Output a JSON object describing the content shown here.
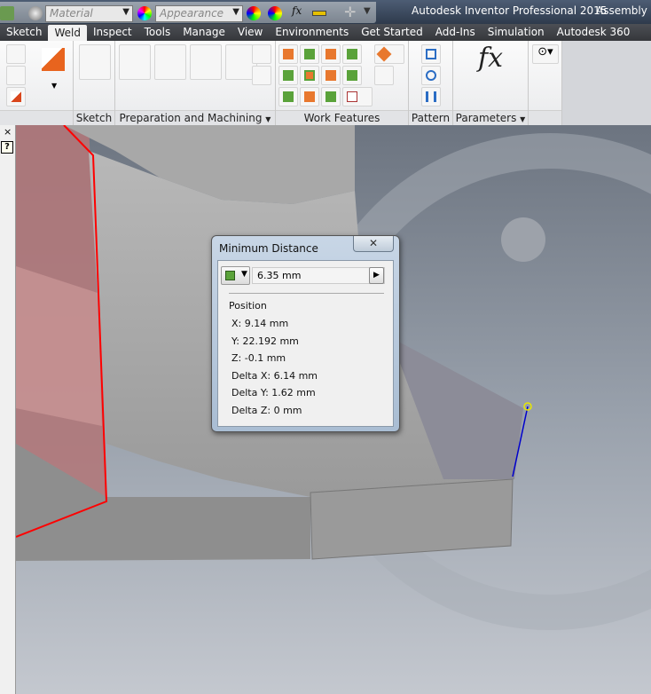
{
  "quick_access": {
    "material_placeholder": "Material",
    "appearance_placeholder": "Appearance",
    "fx_label": "fx"
  },
  "window": {
    "title": "Autodesk Inventor Professional 2015",
    "doc_title": "Assembly S"
  },
  "tabs": [
    {
      "label": "Sketch"
    },
    {
      "label": "Weld",
      "active": true
    },
    {
      "label": "Inspect"
    },
    {
      "label": "Tools"
    },
    {
      "label": "Manage"
    },
    {
      "label": "View"
    },
    {
      "label": "Environments"
    },
    {
      "label": "Get Started"
    },
    {
      "label": "Add-Ins"
    },
    {
      "label": "Simulation"
    },
    {
      "label": "Autodesk 360"
    }
  ],
  "ribbon": {
    "panels": {
      "sketch": "Sketch",
      "prep": "Preparation and Machining",
      "work": "Work Features",
      "pattern": "Pattern",
      "parameters": "Parameters"
    },
    "fx": "fx"
  },
  "left_pane": {
    "close": "×",
    "help": "?"
  },
  "dialog": {
    "title": "Minimum Distance",
    "close": "✕",
    "value": "6.35 mm",
    "position_label": "Position",
    "rows": [
      "X: 9.14 mm",
      "Y: 22.192 mm",
      "Z: -0.1 mm",
      "Delta X: 6.14 mm",
      "Delta Y: 1.62 mm",
      "Delta Z: 0 mm"
    ]
  },
  "colors": {
    "accent_tab": "#f2f2f2",
    "selection_edge": "#ff0000",
    "measure_line": "#0000cc",
    "measure_point": "#e8e800"
  }
}
